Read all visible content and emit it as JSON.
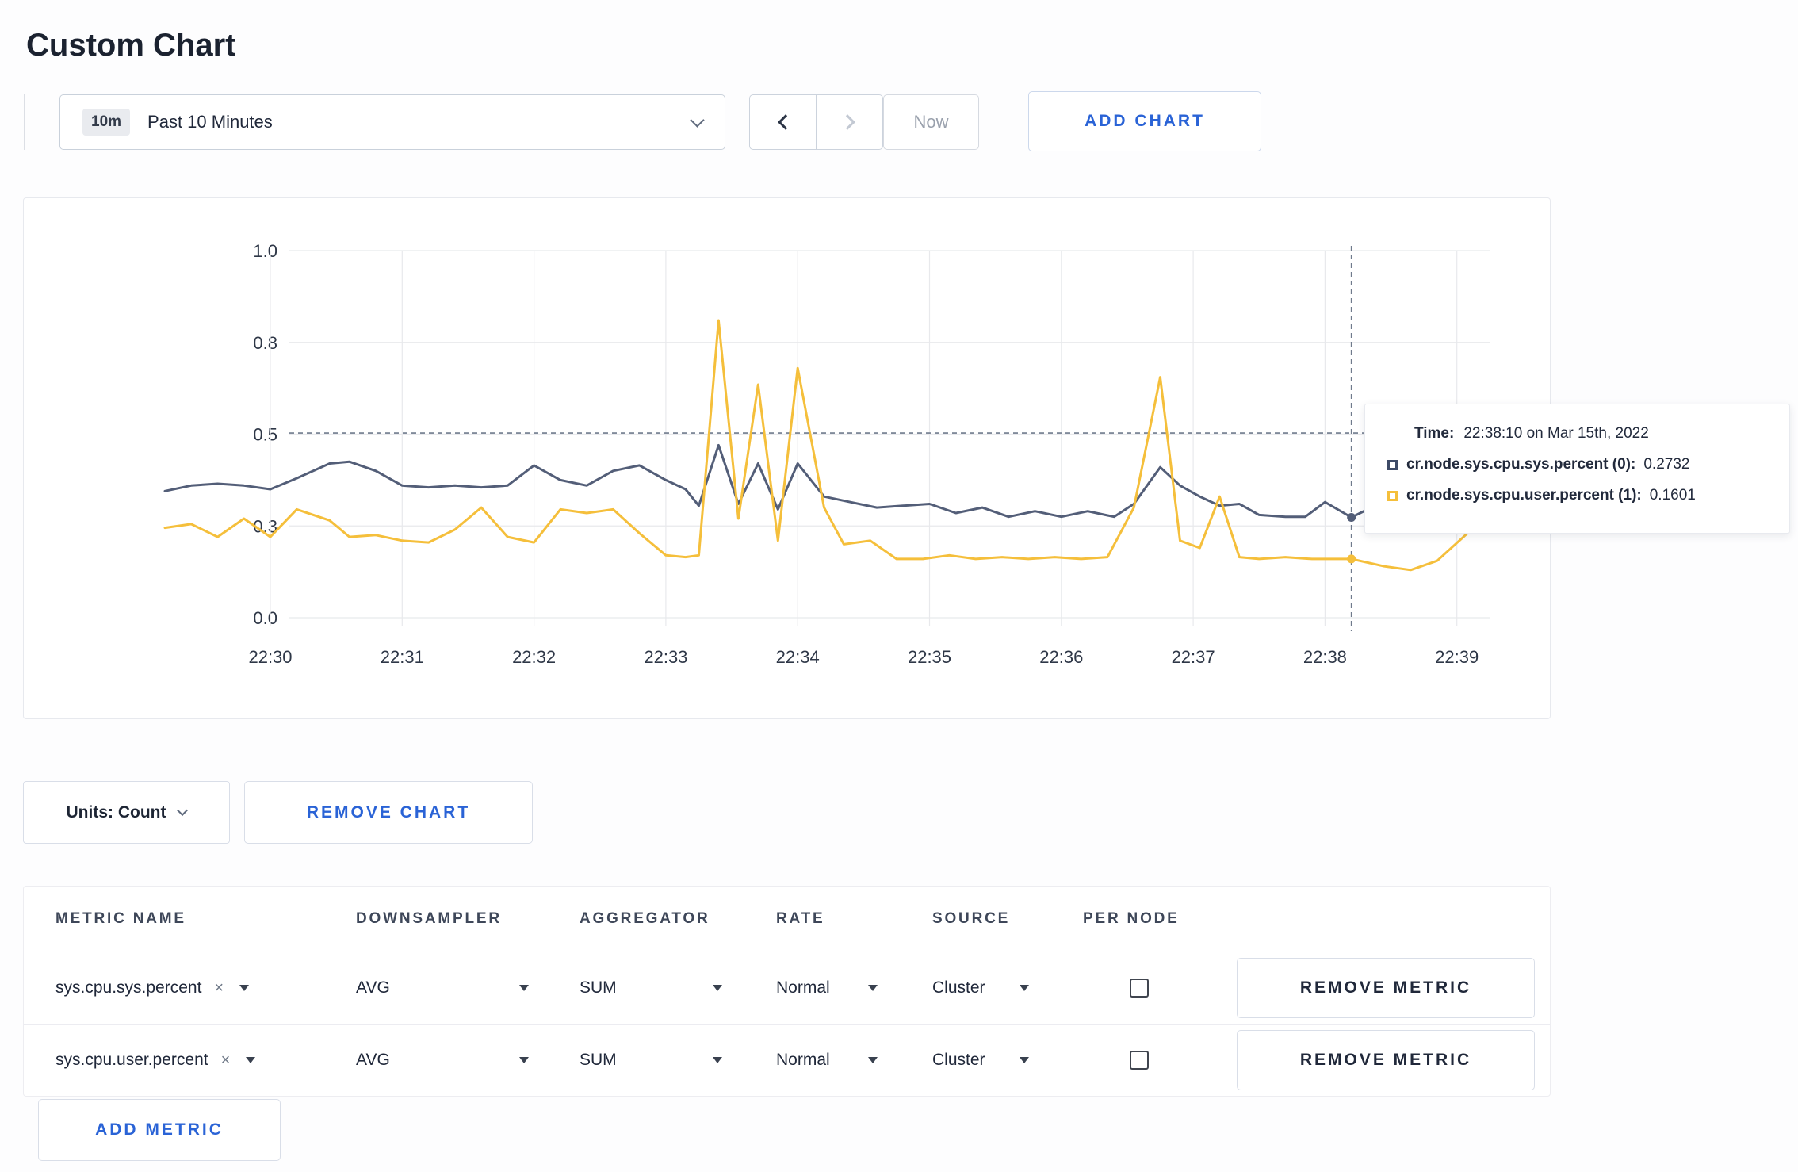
{
  "page": {
    "title": "Custom Chart"
  },
  "toolbar": {
    "time_badge": "10m",
    "time_label": "Past 10 Minutes",
    "now_label": "Now",
    "add_chart_label": "ADD CHART"
  },
  "chart_controls": {
    "units_label": "Units: Count",
    "remove_chart_label": "REMOVE CHART",
    "add_metric_label": "ADD METRIC"
  },
  "tooltip": {
    "time_label": "Time:",
    "time_value": "22:38:10 on Mar 15th, 2022",
    "series": [
      {
        "name": "cr.node.sys.cpu.sys.percent (0):",
        "value": "0.2732",
        "color": "#3d4a66"
      },
      {
        "name": "cr.node.sys.cpu.user.percent (1):",
        "value": "0.1601",
        "color": "#f5bf3b"
      }
    ]
  },
  "metrics_table": {
    "headers": [
      "METRIC NAME",
      "DOWNSAMPLER",
      "AGGREGATOR",
      "RATE",
      "SOURCE",
      "PER NODE"
    ],
    "remove_metric_label": "REMOVE METRIC",
    "rows": [
      {
        "metric": "sys.cpu.sys.percent",
        "remove_icon": "×",
        "downsampler": "AVG",
        "aggregator": "SUM",
        "rate": "Normal",
        "source": "Cluster",
        "per_node_checked": false
      },
      {
        "metric": "sys.cpu.user.percent",
        "remove_icon": "×",
        "downsampler": "AVG",
        "aggregator": "SUM",
        "rate": "Normal",
        "source": "Cluster",
        "per_node_checked": false
      }
    ]
  },
  "chart_data": {
    "type": "line",
    "title": "",
    "xlabel": "",
    "ylabel": "",
    "ylim": [
      0,
      1
    ],
    "x_domain_minutes": [
      29.2,
      39.2
    ],
    "grid": true,
    "legend_position": "tooltip",
    "x_ticks": [
      {
        "t": 30,
        "label": "22:30"
      },
      {
        "t": 31,
        "label": "22:31"
      },
      {
        "t": 32,
        "label": "22:32"
      },
      {
        "t": 33,
        "label": "22:33"
      },
      {
        "t": 34,
        "label": "22:34"
      },
      {
        "t": 35,
        "label": "22:35"
      },
      {
        "t": 36,
        "label": "22:36"
      },
      {
        "t": 37,
        "label": "22:37"
      },
      {
        "t": 38,
        "label": "22:38"
      },
      {
        "t": 39,
        "label": "22:39"
      }
    ],
    "y_ticks": [
      {
        "v": 0.0,
        "label": "0.0"
      },
      {
        "v": 0.25,
        "label": "0.3"
      },
      {
        "v": 0.5,
        "label": "0.5"
      },
      {
        "v": 0.75,
        "label": "0.8"
      },
      {
        "v": 1.0,
        "label": "1.0"
      }
    ],
    "series": [
      {
        "name": "cr.node.sys.cpu.sys.percent",
        "color": "#535e78",
        "points": [
          [
            29.2,
            0.345
          ],
          [
            29.4,
            0.36
          ],
          [
            29.6,
            0.365
          ],
          [
            29.8,
            0.36
          ],
          [
            30.0,
            0.35
          ],
          [
            30.2,
            0.38
          ],
          [
            30.45,
            0.42
          ],
          [
            30.6,
            0.425
          ],
          [
            30.8,
            0.4
          ],
          [
            31.0,
            0.36
          ],
          [
            31.2,
            0.355
          ],
          [
            31.4,
            0.36
          ],
          [
            31.6,
            0.355
          ],
          [
            31.8,
            0.36
          ],
          [
            32.0,
            0.415
          ],
          [
            32.2,
            0.375
          ],
          [
            32.4,
            0.36
          ],
          [
            32.6,
            0.4
          ],
          [
            32.8,
            0.415
          ],
          [
            33.0,
            0.375
          ],
          [
            33.15,
            0.35
          ],
          [
            33.25,
            0.305
          ],
          [
            33.4,
            0.47
          ],
          [
            33.55,
            0.31
          ],
          [
            33.7,
            0.42
          ],
          [
            33.85,
            0.295
          ],
          [
            34.0,
            0.42
          ],
          [
            34.2,
            0.33
          ],
          [
            34.4,
            0.315
          ],
          [
            34.6,
            0.3
          ],
          [
            34.8,
            0.305
          ],
          [
            35.0,
            0.31
          ],
          [
            35.2,
            0.285
          ],
          [
            35.4,
            0.3
          ],
          [
            35.6,
            0.275
          ],
          [
            35.8,
            0.29
          ],
          [
            36.0,
            0.275
          ],
          [
            36.2,
            0.29
          ],
          [
            36.4,
            0.275
          ],
          [
            36.55,
            0.31
          ],
          [
            36.75,
            0.41
          ],
          [
            36.9,
            0.36
          ],
          [
            37.05,
            0.33
          ],
          [
            37.2,
            0.305
          ],
          [
            37.35,
            0.31
          ],
          [
            37.5,
            0.28
          ],
          [
            37.7,
            0.275
          ],
          [
            37.85,
            0.275
          ],
          [
            38.0,
            0.315
          ],
          [
            38.2,
            0.2732
          ],
          [
            38.35,
            0.3
          ]
        ]
      },
      {
        "name": "cr.node.sys.cpu.user.percent",
        "color": "#f5bf3b",
        "points": [
          [
            29.2,
            0.245
          ],
          [
            29.4,
            0.255
          ],
          [
            29.6,
            0.22
          ],
          [
            29.8,
            0.27
          ],
          [
            30.0,
            0.22
          ],
          [
            30.2,
            0.295
          ],
          [
            30.45,
            0.265
          ],
          [
            30.6,
            0.22
          ],
          [
            30.8,
            0.225
          ],
          [
            31.0,
            0.21
          ],
          [
            31.2,
            0.205
          ],
          [
            31.4,
            0.24
          ],
          [
            31.6,
            0.3
          ],
          [
            31.8,
            0.22
          ],
          [
            32.0,
            0.205
          ],
          [
            32.2,
            0.295
          ],
          [
            32.4,
            0.285
          ],
          [
            32.6,
            0.295
          ],
          [
            32.8,
            0.23
          ],
          [
            33.0,
            0.17
          ],
          [
            33.15,
            0.165
          ],
          [
            33.25,
            0.17
          ],
          [
            33.4,
            0.81
          ],
          [
            33.55,
            0.27
          ],
          [
            33.7,
            0.635
          ],
          [
            33.85,
            0.21
          ],
          [
            34.0,
            0.68
          ],
          [
            34.2,
            0.3
          ],
          [
            34.35,
            0.2
          ],
          [
            34.55,
            0.21
          ],
          [
            34.75,
            0.16
          ],
          [
            34.95,
            0.16
          ],
          [
            35.15,
            0.17
          ],
          [
            35.35,
            0.16
          ],
          [
            35.55,
            0.165
          ],
          [
            35.75,
            0.16
          ],
          [
            35.95,
            0.165
          ],
          [
            36.15,
            0.16
          ],
          [
            36.35,
            0.165
          ],
          [
            36.55,
            0.3
          ],
          [
            36.75,
            0.655
          ],
          [
            36.9,
            0.21
          ],
          [
            37.05,
            0.19
          ],
          [
            37.2,
            0.33
          ],
          [
            37.35,
            0.165
          ],
          [
            37.5,
            0.16
          ],
          [
            37.7,
            0.165
          ],
          [
            37.9,
            0.16
          ],
          [
            38.1,
            0.16
          ],
          [
            38.2,
            0.1601
          ],
          [
            38.45,
            0.14
          ],
          [
            38.65,
            0.13
          ],
          [
            38.85,
            0.155
          ],
          [
            39.05,
            0.22
          ],
          [
            39.2,
            0.27
          ]
        ]
      }
    ],
    "crosshair": {
      "t": 38.2,
      "hline_v": 0.503,
      "marker_values": [
        0.2732,
        0.1601
      ]
    }
  }
}
